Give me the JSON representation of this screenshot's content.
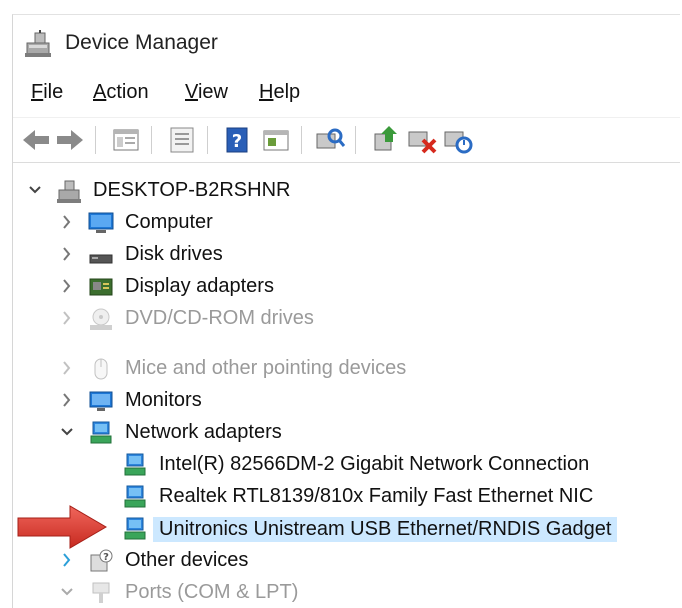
{
  "window": {
    "title": "Device Manager"
  },
  "menu": [
    {
      "label": "File",
      "accel": "F",
      "rest": "ile"
    },
    {
      "label": "Action",
      "accel": "A",
      "rest": "ction"
    },
    {
      "label": "View",
      "accel": "V",
      "rest": "iew"
    },
    {
      "label": "Help",
      "accel": "H",
      "rest": "elp"
    }
  ],
  "toolbar": [
    "back-arrow-icon",
    "forward-arrow-icon",
    "properties-icon",
    "update-driver-icon",
    "help-icon",
    "show-hidden-icon",
    "scan-hardware-icon",
    "add-driver-icon",
    "uninstall-device-icon",
    "disable-device-icon"
  ],
  "tree": {
    "root": {
      "label": "DESKTOP-B2RSHNR",
      "expanded": true
    },
    "items": [
      {
        "label": "Computer",
        "icon": "computer-icon",
        "expanded": false
      },
      {
        "label": "Disk drives",
        "icon": "disk-drive-icon",
        "expanded": false
      },
      {
        "label": "Display adapters",
        "icon": "display-adapter-icon",
        "expanded": false
      },
      {
        "label": "DVD/CD-ROM drives",
        "icon": "dvd-drive-icon",
        "expanded": false,
        "faded": true
      },
      {
        "label": "Mice and other pointing devices",
        "icon": "mouse-icon",
        "expanded": false,
        "faded": true
      },
      {
        "label": "Monitors",
        "icon": "monitor-icon",
        "expanded": false
      },
      {
        "label": "Network adapters",
        "icon": "network-adapter-icon",
        "expanded": true,
        "children": [
          {
            "label": "Intel(R) 82566DM-2 Gigabit Network Connection",
            "icon": "network-adapter-icon"
          },
          {
            "label": "Realtek RTL8139/810x Family Fast Ethernet NIC",
            "icon": "network-adapter-icon"
          },
          {
            "label": "Unitronics Unistream USB Ethernet/RNDIS Gadget",
            "icon": "network-adapter-icon",
            "selected": true
          }
        ]
      },
      {
        "label": "Other devices",
        "icon": "other-devices-icon",
        "expanded": false
      },
      {
        "label": "Ports (COM & LPT)",
        "icon": "ports-icon",
        "expanded": true,
        "faded": true
      }
    ]
  },
  "colors": {
    "selection": "#cce8ff",
    "arrow": "#e03c31",
    "accent": "#1e78d7"
  }
}
